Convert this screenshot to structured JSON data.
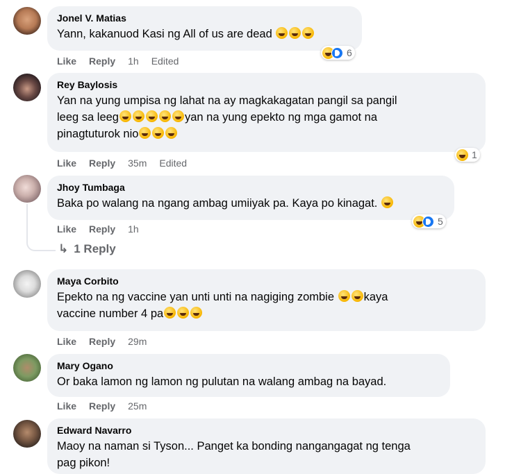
{
  "comments": [
    {
      "author": "Jonel V. Matias",
      "text": "Yann, kakanuod Kasi ng All of us are dead",
      "trail_emojis": 3,
      "like": "Like",
      "reply": "Reply",
      "time": "1h",
      "edited": "Edited",
      "reaction_count": "6"
    },
    {
      "author": "Rey Baylosis",
      "line1": "Yan na yung umpisa ng lahat na ay magkakagatan pangil sa pangil",
      "line2a": "leeg sa leeg",
      "line2b": "yan na yung epekto ng mga gamot na",
      "line3": "pinagtuturok nio",
      "like": "Like",
      "reply": "Reply",
      "time": "35m",
      "edited": "Edited",
      "reaction_count": "1"
    },
    {
      "author": "Jhoy Tumbaga",
      "text": "Baka po walang na ngang ambag umiiyak pa. Kaya po kinagat.",
      "like": "Like",
      "reply": "Reply",
      "time": "1h",
      "reaction_count": "5",
      "replies_label": "1 Reply"
    },
    {
      "author": "Maya Corbito",
      "line1": "Epekto na ng vaccine yan unti unti na nagiging zombie",
      "line1b": "kaya",
      "line2": "vaccine number 4 pa",
      "like": "Like",
      "reply": "Reply",
      "time": "29m"
    },
    {
      "author": "Mary Ogano",
      "text": "Or baka lamon ng lamon ng pulutan na walang ambag na bayad.",
      "like": "Like",
      "reply": "Reply",
      "time": "25m"
    },
    {
      "author": "Edward Navarro",
      "line1": "Maoy na naman si Tyson... Panget ka bonding nangangagat ng tenga",
      "line2": "pag pikon!"
    }
  ],
  "colors": {
    "bubble": "#f0f2f5",
    "meta": "#65676b",
    "care": "#1877f2"
  }
}
